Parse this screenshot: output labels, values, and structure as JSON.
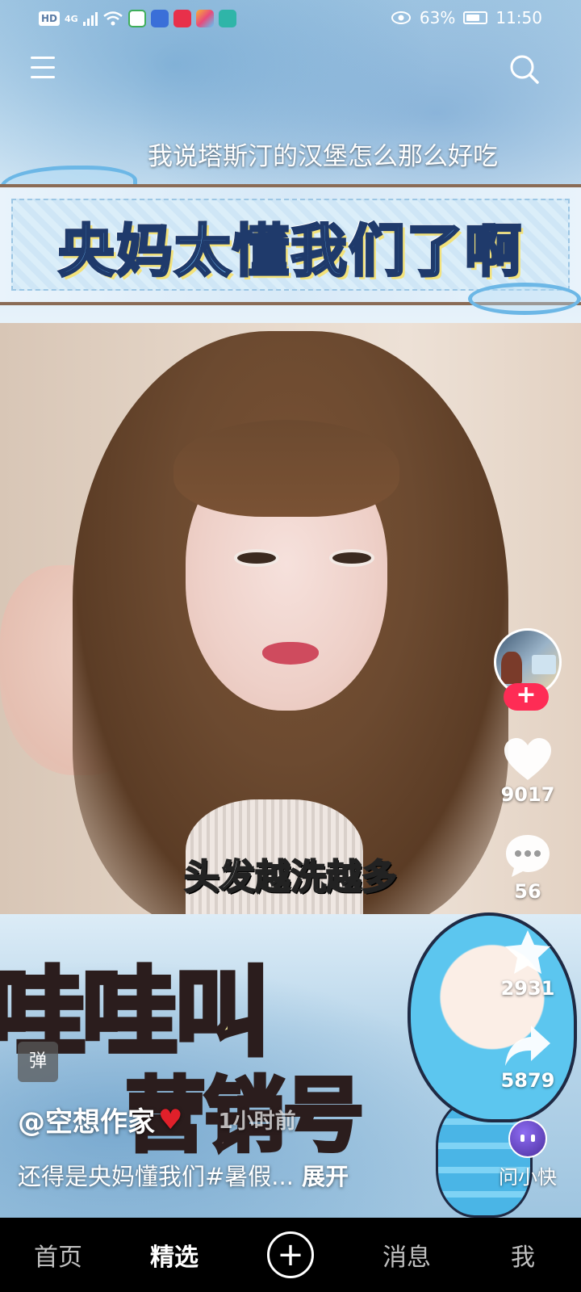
{
  "status_bar": {
    "hd": "HD",
    "network": "4G",
    "battery": "63%",
    "time": "11:50"
  },
  "header": {
    "menu_icon": "hamburger-menu-icon",
    "search_icon": "search-icon"
  },
  "video": {
    "top_subtitle": "我说塔斯汀的汉堡怎么那么好吃",
    "banner_title": "央妈太懂我们了啊",
    "photo_caption": "头发越洗越多",
    "comic_line1": "哇哇叫",
    "comic_line2": "营销号"
  },
  "creator": {
    "follow_symbol": "+"
  },
  "actions": {
    "like_count": "9017",
    "comment_count": "56",
    "favorite_count": "2931",
    "share_count": "5879",
    "assistant_label": "问小快"
  },
  "post": {
    "tag_badge": "弹",
    "author": "@空想作家",
    "author_emoji": "♥",
    "time_text": "1小时前",
    "description": "还得是央妈懂我们#暑假...",
    "expand_label": "展开"
  },
  "bottom_nav": {
    "items": [
      "首页",
      "精选",
      "消息",
      "我"
    ],
    "active": "精选",
    "plus": "+"
  }
}
